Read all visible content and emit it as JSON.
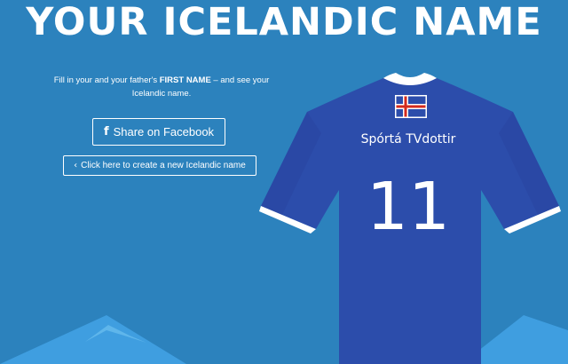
{
  "page": {
    "title": "YOUR ICELANDIC NAME"
  },
  "instructions": {
    "before": "Fill in your and your father's ",
    "emphasis": "FIRST NAME",
    "after": " – and see your Icelandic name."
  },
  "actions": {
    "share_label": "Share on Facebook",
    "share_icon": "facebook-icon",
    "new_name_label": "Click here to create a new Icelandic name",
    "new_name_icon": "chevron-left-icon"
  },
  "jersey": {
    "player_name": "Spórtá TVdottir",
    "number": "11",
    "flag_icon": "iceland-flag-icon"
  },
  "colors": {
    "background": "#2c82bd",
    "jersey_blue": "#2c4dab",
    "jersey_trim": "#ffffff",
    "mountain_light": "#3f9ee0",
    "flag_red": "#d52b1e"
  }
}
